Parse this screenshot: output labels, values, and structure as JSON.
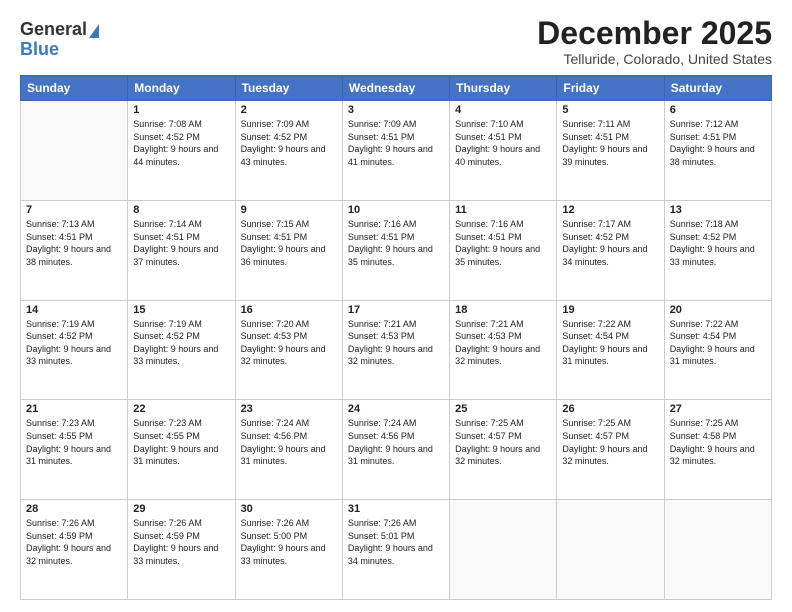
{
  "logo": {
    "line1": "General",
    "line2": "Blue"
  },
  "title": "December 2025",
  "subtitle": "Telluride, Colorado, United States",
  "days_of_week": [
    "Sunday",
    "Monday",
    "Tuesday",
    "Wednesday",
    "Thursday",
    "Friday",
    "Saturday"
  ],
  "weeks": [
    [
      {
        "day": "",
        "sunrise": "",
        "sunset": "",
        "daylight": ""
      },
      {
        "day": "1",
        "sunrise": "7:08 AM",
        "sunset": "4:52 PM",
        "daylight": "9 hours and 44 minutes."
      },
      {
        "day": "2",
        "sunrise": "7:09 AM",
        "sunset": "4:52 PM",
        "daylight": "9 hours and 43 minutes."
      },
      {
        "day": "3",
        "sunrise": "7:09 AM",
        "sunset": "4:51 PM",
        "daylight": "9 hours and 41 minutes."
      },
      {
        "day": "4",
        "sunrise": "7:10 AM",
        "sunset": "4:51 PM",
        "daylight": "9 hours and 40 minutes."
      },
      {
        "day": "5",
        "sunrise": "7:11 AM",
        "sunset": "4:51 PM",
        "daylight": "9 hours and 39 minutes."
      },
      {
        "day": "6",
        "sunrise": "7:12 AM",
        "sunset": "4:51 PM",
        "daylight": "9 hours and 38 minutes."
      }
    ],
    [
      {
        "day": "7",
        "sunrise": "7:13 AM",
        "sunset": "4:51 PM",
        "daylight": "9 hours and 38 minutes."
      },
      {
        "day": "8",
        "sunrise": "7:14 AM",
        "sunset": "4:51 PM",
        "daylight": "9 hours and 37 minutes."
      },
      {
        "day": "9",
        "sunrise": "7:15 AM",
        "sunset": "4:51 PM",
        "daylight": "9 hours and 36 minutes."
      },
      {
        "day": "10",
        "sunrise": "7:16 AM",
        "sunset": "4:51 PM",
        "daylight": "9 hours and 35 minutes."
      },
      {
        "day": "11",
        "sunrise": "7:16 AM",
        "sunset": "4:51 PM",
        "daylight": "9 hours and 35 minutes."
      },
      {
        "day": "12",
        "sunrise": "7:17 AM",
        "sunset": "4:52 PM",
        "daylight": "9 hours and 34 minutes."
      },
      {
        "day": "13",
        "sunrise": "7:18 AM",
        "sunset": "4:52 PM",
        "daylight": "9 hours and 33 minutes."
      }
    ],
    [
      {
        "day": "14",
        "sunrise": "7:19 AM",
        "sunset": "4:52 PM",
        "daylight": "9 hours and 33 minutes."
      },
      {
        "day": "15",
        "sunrise": "7:19 AM",
        "sunset": "4:52 PM",
        "daylight": "9 hours and 33 minutes."
      },
      {
        "day": "16",
        "sunrise": "7:20 AM",
        "sunset": "4:53 PM",
        "daylight": "9 hours and 32 minutes."
      },
      {
        "day": "17",
        "sunrise": "7:21 AM",
        "sunset": "4:53 PM",
        "daylight": "9 hours and 32 minutes."
      },
      {
        "day": "18",
        "sunrise": "7:21 AM",
        "sunset": "4:53 PM",
        "daylight": "9 hours and 32 minutes."
      },
      {
        "day": "19",
        "sunrise": "7:22 AM",
        "sunset": "4:54 PM",
        "daylight": "9 hours and 31 minutes."
      },
      {
        "day": "20",
        "sunrise": "7:22 AM",
        "sunset": "4:54 PM",
        "daylight": "9 hours and 31 minutes."
      }
    ],
    [
      {
        "day": "21",
        "sunrise": "7:23 AM",
        "sunset": "4:55 PM",
        "daylight": "9 hours and 31 minutes."
      },
      {
        "day": "22",
        "sunrise": "7:23 AM",
        "sunset": "4:55 PM",
        "daylight": "9 hours and 31 minutes."
      },
      {
        "day": "23",
        "sunrise": "7:24 AM",
        "sunset": "4:56 PM",
        "daylight": "9 hours and 31 minutes."
      },
      {
        "day": "24",
        "sunrise": "7:24 AM",
        "sunset": "4:56 PM",
        "daylight": "9 hours and 31 minutes."
      },
      {
        "day": "25",
        "sunrise": "7:25 AM",
        "sunset": "4:57 PM",
        "daylight": "9 hours and 32 minutes."
      },
      {
        "day": "26",
        "sunrise": "7:25 AM",
        "sunset": "4:57 PM",
        "daylight": "9 hours and 32 minutes."
      },
      {
        "day": "27",
        "sunrise": "7:25 AM",
        "sunset": "4:58 PM",
        "daylight": "9 hours and 32 minutes."
      }
    ],
    [
      {
        "day": "28",
        "sunrise": "7:26 AM",
        "sunset": "4:59 PM",
        "daylight": "9 hours and 32 minutes."
      },
      {
        "day": "29",
        "sunrise": "7:26 AM",
        "sunset": "4:59 PM",
        "daylight": "9 hours and 33 minutes."
      },
      {
        "day": "30",
        "sunrise": "7:26 AM",
        "sunset": "5:00 PM",
        "daylight": "9 hours and 33 minutes."
      },
      {
        "day": "31",
        "sunrise": "7:26 AM",
        "sunset": "5:01 PM",
        "daylight": "9 hours and 34 minutes."
      },
      {
        "day": "",
        "sunrise": "",
        "sunset": "",
        "daylight": ""
      },
      {
        "day": "",
        "sunrise": "",
        "sunset": "",
        "daylight": ""
      },
      {
        "day": "",
        "sunrise": "",
        "sunset": "",
        "daylight": ""
      }
    ]
  ]
}
